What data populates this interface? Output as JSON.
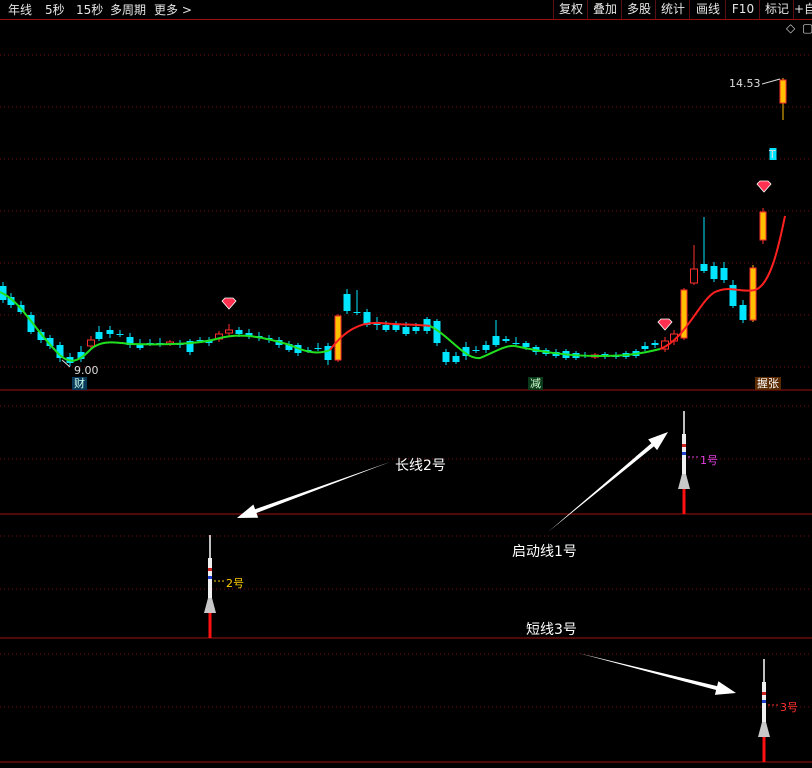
{
  "toolbar": {
    "left": [
      "年线",
      "5秒",
      "15秒",
      "多周期",
      "更多 >"
    ],
    "right": [
      "复权",
      "叠加",
      "多股",
      "统计",
      "画线",
      "F10",
      "标记",
      "+自"
    ]
  },
  "main_chart": {
    "price_high_label": "14.53",
    "price_low_label": "9.00",
    "signals": {
      "cai": "财",
      "jian": "减",
      "zhang": "握张"
    }
  },
  "subcharts": {
    "rocket1_label": "1号",
    "rocket2_label": "2号",
    "rocket3_label": "3号"
  },
  "annotations": {
    "line2": "长线2号",
    "line1": "启动线1号",
    "line3": "短线3号"
  },
  "colors": {
    "up": "#ff3030",
    "down": "#00e5ff",
    "ma_up": "#ff2020",
    "ma_down": "#20e020",
    "gold": "#ffc000",
    "grid": "#a01010"
  }
}
